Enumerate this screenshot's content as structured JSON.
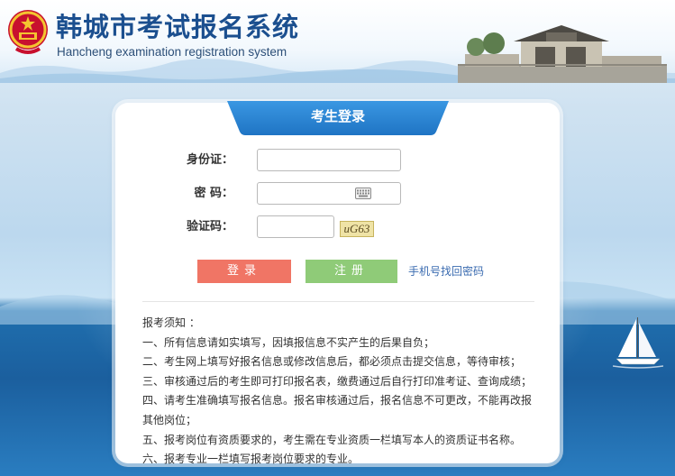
{
  "header": {
    "title": "韩城市考试报名系统",
    "subtitle": "Hancheng examination registration system"
  },
  "login": {
    "tab_title": "考生登录",
    "id_label": "身份证：",
    "password_label": "密 码：",
    "captcha_label": "验证码：",
    "id_value": "",
    "password_value": "",
    "captcha_value": "",
    "captcha_image_text": "uG63",
    "login_button": "登录",
    "register_button": "注册",
    "recover_link": "手机号找回密码"
  },
  "notice": {
    "heading": "报考须知 ：",
    "items": [
      "一、所有信息请如实填写，因填报信息不实产生的后果自负；",
      "二、考生网上填写好报名信息或修改信息后，都必须点击提交信息，等待审核；",
      "三、审核通过后的考生即可打印报名表，缴费通过后自行打印准考证、查询成绩；",
      "四、请考生准确填写报名信息。报名审核通过后，报名信息不可更改，不能再改报其他岗位；",
      "五、报考岗位有资质要求的，考生需在专业资质一栏填写本人的资质证书名称。",
      "六、报考专业一栏填写报考岗位要求的专业。"
    ]
  },
  "icons": {
    "emblem": "national-emblem-icon",
    "keyboard": "keyboard-icon",
    "building": "city-gate-illustration",
    "sailboat": "sailboat-illustration"
  },
  "colors": {
    "title_blue": "#1b4f8f",
    "tab_blue": "#2a86d6",
    "login_red": "#f07565",
    "register_green": "#8fcb78",
    "link_blue": "#3a6bb0"
  }
}
